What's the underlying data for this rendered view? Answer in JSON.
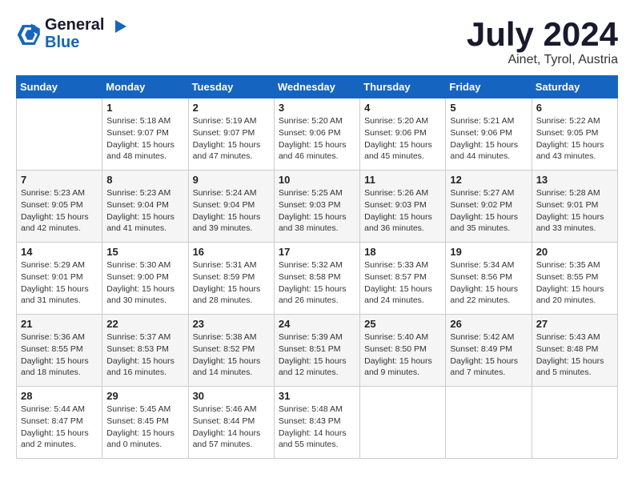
{
  "header": {
    "logo_line1": "General",
    "logo_line2": "Blue",
    "month_year": "July 2024",
    "location": "Ainet, Tyrol, Austria"
  },
  "days_of_week": [
    "Sunday",
    "Monday",
    "Tuesday",
    "Wednesday",
    "Thursday",
    "Friday",
    "Saturday"
  ],
  "weeks": [
    [
      {
        "day": "",
        "info": ""
      },
      {
        "day": "1",
        "info": "Sunrise: 5:18 AM\nSunset: 9:07 PM\nDaylight: 15 hours\nand 48 minutes."
      },
      {
        "day": "2",
        "info": "Sunrise: 5:19 AM\nSunset: 9:07 PM\nDaylight: 15 hours\nand 47 minutes."
      },
      {
        "day": "3",
        "info": "Sunrise: 5:20 AM\nSunset: 9:06 PM\nDaylight: 15 hours\nand 46 minutes."
      },
      {
        "day": "4",
        "info": "Sunrise: 5:20 AM\nSunset: 9:06 PM\nDaylight: 15 hours\nand 45 minutes."
      },
      {
        "day": "5",
        "info": "Sunrise: 5:21 AM\nSunset: 9:06 PM\nDaylight: 15 hours\nand 44 minutes."
      },
      {
        "day": "6",
        "info": "Sunrise: 5:22 AM\nSunset: 9:05 PM\nDaylight: 15 hours\nand 43 minutes."
      }
    ],
    [
      {
        "day": "7",
        "info": "Sunrise: 5:23 AM\nSunset: 9:05 PM\nDaylight: 15 hours\nand 42 minutes."
      },
      {
        "day": "8",
        "info": "Sunrise: 5:23 AM\nSunset: 9:04 PM\nDaylight: 15 hours\nand 41 minutes."
      },
      {
        "day": "9",
        "info": "Sunrise: 5:24 AM\nSunset: 9:04 PM\nDaylight: 15 hours\nand 39 minutes."
      },
      {
        "day": "10",
        "info": "Sunrise: 5:25 AM\nSunset: 9:03 PM\nDaylight: 15 hours\nand 38 minutes."
      },
      {
        "day": "11",
        "info": "Sunrise: 5:26 AM\nSunset: 9:03 PM\nDaylight: 15 hours\nand 36 minutes."
      },
      {
        "day": "12",
        "info": "Sunrise: 5:27 AM\nSunset: 9:02 PM\nDaylight: 15 hours\nand 35 minutes."
      },
      {
        "day": "13",
        "info": "Sunrise: 5:28 AM\nSunset: 9:01 PM\nDaylight: 15 hours\nand 33 minutes."
      }
    ],
    [
      {
        "day": "14",
        "info": "Sunrise: 5:29 AM\nSunset: 9:01 PM\nDaylight: 15 hours\nand 31 minutes."
      },
      {
        "day": "15",
        "info": "Sunrise: 5:30 AM\nSunset: 9:00 PM\nDaylight: 15 hours\nand 30 minutes."
      },
      {
        "day": "16",
        "info": "Sunrise: 5:31 AM\nSunset: 8:59 PM\nDaylight: 15 hours\nand 28 minutes."
      },
      {
        "day": "17",
        "info": "Sunrise: 5:32 AM\nSunset: 8:58 PM\nDaylight: 15 hours\nand 26 minutes."
      },
      {
        "day": "18",
        "info": "Sunrise: 5:33 AM\nSunset: 8:57 PM\nDaylight: 15 hours\nand 24 minutes."
      },
      {
        "day": "19",
        "info": "Sunrise: 5:34 AM\nSunset: 8:56 PM\nDaylight: 15 hours\nand 22 minutes."
      },
      {
        "day": "20",
        "info": "Sunrise: 5:35 AM\nSunset: 8:55 PM\nDaylight: 15 hours\nand 20 minutes."
      }
    ],
    [
      {
        "day": "21",
        "info": "Sunrise: 5:36 AM\nSunset: 8:55 PM\nDaylight: 15 hours\nand 18 minutes."
      },
      {
        "day": "22",
        "info": "Sunrise: 5:37 AM\nSunset: 8:53 PM\nDaylight: 15 hours\nand 16 minutes."
      },
      {
        "day": "23",
        "info": "Sunrise: 5:38 AM\nSunset: 8:52 PM\nDaylight: 15 hours\nand 14 minutes."
      },
      {
        "day": "24",
        "info": "Sunrise: 5:39 AM\nSunset: 8:51 PM\nDaylight: 15 hours\nand 12 minutes."
      },
      {
        "day": "25",
        "info": "Sunrise: 5:40 AM\nSunset: 8:50 PM\nDaylight: 15 hours\nand 9 minutes."
      },
      {
        "day": "26",
        "info": "Sunrise: 5:42 AM\nSunset: 8:49 PM\nDaylight: 15 hours\nand 7 minutes."
      },
      {
        "day": "27",
        "info": "Sunrise: 5:43 AM\nSunset: 8:48 PM\nDaylight: 15 hours\nand 5 minutes."
      }
    ],
    [
      {
        "day": "28",
        "info": "Sunrise: 5:44 AM\nSunset: 8:47 PM\nDaylight: 15 hours\nand 2 minutes."
      },
      {
        "day": "29",
        "info": "Sunrise: 5:45 AM\nSunset: 8:45 PM\nDaylight: 15 hours\nand 0 minutes."
      },
      {
        "day": "30",
        "info": "Sunrise: 5:46 AM\nSunset: 8:44 PM\nDaylight: 14 hours\nand 57 minutes."
      },
      {
        "day": "31",
        "info": "Sunrise: 5:48 AM\nSunset: 8:43 PM\nDaylight: 14 hours\nand 55 minutes."
      },
      {
        "day": "",
        "info": ""
      },
      {
        "day": "",
        "info": ""
      },
      {
        "day": "",
        "info": ""
      }
    ]
  ]
}
